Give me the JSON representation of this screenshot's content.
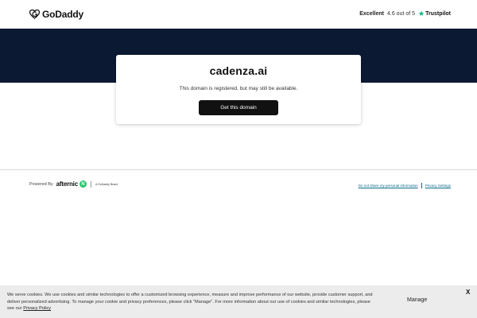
{
  "header": {
    "logo_text": "GoDaddy",
    "logo_icon": "godaddy-heart-icon",
    "trustpilot": {
      "rating_word": "Excellent",
      "score_text": "4.6 out of 5",
      "brand": "Trustpilot",
      "star_icon": "trustpilot-star-icon"
    }
  },
  "colors": {
    "hero_bg": "#0c1932",
    "button_bg": "#111111",
    "trustpilot_green": "#00b67a",
    "afternic_green": "#27c46a",
    "cookie_bg": "#ececec"
  },
  "card": {
    "domain": "cadenza.ai",
    "status": "This domain is registered, but may still be available.",
    "cta_label": "Get this domain"
  },
  "footer": {
    "powered_by": "Powered By",
    "afternic": "afternic",
    "afternic_icon": "afternic-n-icon",
    "brand_note": "A GoDaddy Brand",
    "links": [
      "Do not share my personal information",
      "Privacy Settings"
    ]
  },
  "cookie": {
    "text": "We serve cookies. We use cookies and similar technologies to offer a customized browsing experience, measure and improve performance of our website, provide customer support, and deliver personalized advertising. To manage your cookie and privacy preferences, please click \"Manage\". For more information about our use of cookies and similar technologies, please see our",
    "policy_link": "Privacy Policy",
    "manage_label": "Manage",
    "close_label": "X"
  }
}
